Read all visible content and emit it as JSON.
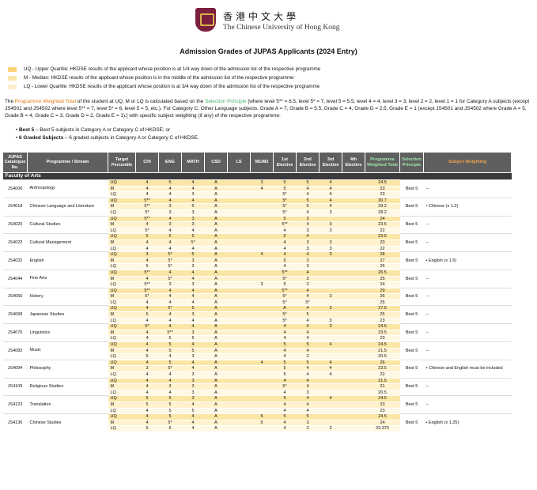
{
  "header": {
    "university_cn": "香港中文大學",
    "university_en": "The Chinese University of Hong Kong"
  },
  "title": "Admission Grades of JUPAS Applicants (2024 Entry)",
  "legend": [
    {
      "text": "UQ - Upper Quartile:  HKDSE results of the applicant whose position is at 1/4 way down of the admission list of the respective programme",
      "color": "#fbd27a"
    },
    {
      "text": "M - Median:  HKDSE results of the applicant whose position is in the middle of the admission list of the respective programme",
      "color": "#fce4a8"
    },
    {
      "text": "LQ - Lower Quartile:  HKDSE results of the applicant whose position is at 3/4 way down of the admission list of the respective programme",
      "color": "#fdeecb"
    }
  ],
  "note": {
    "p1": "The ",
    "pwt": "Programme Weighted Total",
    "p2": " of the student at UQ, M or LQ is calculated based on the ",
    "sp": "Selection Principle",
    "p3": " [where level 5** = 8.5, level 5* = 7, level 5 = 5.5, level 4 = 4, level 3 = 3, level 2 = 2, level 1 = 1 for Category A subjects (except JS4501 and JS4502 where level 5** = 7, level 5* = 6, level 5 = 5, etc.). For Category C: Other Language subjects, Grade A = 7, Grade B = 5.5, Grade C = 4, Grade D = 2.5, Grade E = 1 (except JS4501 and JS4502 where Grade A = 5, Grade B = 4, Grade C = 3, Grade D = 2, Grade E = 1).] with specific subject weighting (if any) of the respective programme:"
  },
  "bullets": [
    {
      "bold": "Best 5",
      "text": " – Best 5 subjects in Category A or Category C of HKDSE; or"
    },
    {
      "bold": "6 Graded Subjects",
      "text": " – 6 graded subjects in Category A or Category C of HKDSE."
    }
  ],
  "table": {
    "headers": {
      "catalogue": "JUPAS Catalogue No.",
      "programme": "Programme / Stream",
      "target": "Target Percentile",
      "chi": "CHI",
      "eng": "ENG",
      "math": "MATH",
      "csd": "CSD",
      "ls": "LS",
      "m1m2": "M1/M2",
      "e1": "1st Elective",
      "e2": "2nd Elective",
      "e3": "3rd Elective",
      "e4": "4th Elective",
      "pwt": "Programme Weighted Total",
      "sel": "Selection Principle",
      "wt": "Subject Weighting"
    },
    "faculty": "Faculty of Arts",
    "programmes": [
      {
        "code": "JS4006",
        "name": "Anthropology",
        "sel": "Best 5",
        "weight": "--",
        "rows": [
          {
            "p": "UQ",
            "chi": "4",
            "eng": "5",
            "math": "4",
            "csd": "A",
            "ls": "",
            "m": "3",
            "e1": "5",
            "e2": "5",
            "e3": "4",
            "e4": "",
            "total": "24.5"
          },
          {
            "p": "M",
            "chi": "4",
            "eng": "4",
            "math": "4",
            "csd": "A",
            "ls": "",
            "m": "4",
            "e1": "5",
            "e2": "4",
            "e3": "4",
            "e4": "",
            "total": "23"
          },
          {
            "p": "LQ",
            "chi": "4",
            "eng": "4",
            "math": "3",
            "csd": "A",
            "ls": "",
            "m": "",
            "e1": "5*",
            "e2": "4",
            "e3": "4",
            "e4": "",
            "total": "23"
          }
        ]
      },
      {
        "code": "JS4018",
        "name": "Chinese Language and Literature",
        "sel": "Best 5",
        "weight": "• Chinese (x 1.2)",
        "rows": [
          {
            "p": "UQ",
            "chi": "5**",
            "eng": "4",
            "math": "4",
            "csd": "A",
            "ls": "",
            "m": "",
            "e1": "5*",
            "e2": "5",
            "e3": "4",
            "e4": "",
            "total": "30.7"
          },
          {
            "p": "M",
            "chi": "5**",
            "eng": "3",
            "math": "5",
            "csd": "A",
            "ls": "",
            "m": "",
            "e1": "5*",
            "e2": "5",
            "e3": "4",
            "e4": "",
            "total": "29.2"
          },
          {
            "p": "LQ",
            "chi": "5*",
            "eng": "3",
            "math": "3",
            "csd": "A",
            "ls": "",
            "m": "",
            "e1": "5*",
            "e2": "4",
            "e3": "3",
            "e4": "",
            "total": "28.2"
          }
        ]
      },
      {
        "code": "JS4020",
        "name": "Cultural Studies",
        "sel": "Best 5",
        "weight": "--",
        "rows": [
          {
            "p": "UQ",
            "chi": "5**",
            "eng": "4",
            "math": "3",
            "csd": "A",
            "ls": "",
            "m": "",
            "e1": "5",
            "e2": "3",
            "e3": "",
            "e4": "",
            "total": "24"
          },
          {
            "p": "M",
            "chi": "4",
            "eng": "3",
            "math": "3",
            "csd": "A",
            "ls": "",
            "m": "",
            "e1": "5**",
            "e2": "4",
            "e3": "3",
            "e4": "",
            "total": "23.5"
          },
          {
            "p": "LQ",
            "chi": "5*",
            "eng": "4",
            "math": "4",
            "csd": "A",
            "ls": "",
            "m": "",
            "e1": "4",
            "e2": "3",
            "e3": "3",
            "e4": "",
            "total": "22"
          }
        ]
      },
      {
        "code": "JS4022",
        "name": "Cultural Management",
        "sel": "Best 5",
        "weight": "--",
        "rows": [
          {
            "p": "UQ",
            "chi": "5",
            "eng": "5",
            "math": "5",
            "csd": "A",
            "ls": "",
            "m": "",
            "e1": "5",
            "e2": "4",
            "e3": "",
            "e4": "",
            "total": "23.5"
          },
          {
            "p": "M",
            "chi": "4",
            "eng": "4",
            "math": "5*",
            "csd": "A",
            "ls": "",
            "m": "",
            "e1": "4",
            "e2": "3",
            "e3": "3",
            "e4": "",
            "total": "23"
          },
          {
            "p": "LQ",
            "chi": "4",
            "eng": "4",
            "math": "4",
            "csd": "A",
            "ls": "",
            "m": "",
            "e1": "4",
            "e2": "3",
            "e3": "3",
            "e4": "",
            "total": "22"
          }
        ]
      },
      {
        "code": "JS4032",
        "name": "English",
        "sel": "Best 5",
        "weight": "• English (x 1.5)",
        "rows": [
          {
            "p": "UQ",
            "chi": "3",
            "eng": "5*",
            "math": "5",
            "csd": "A",
            "ls": "",
            "m": "4",
            "e1": "4",
            "e2": "4",
            "e3": "3",
            "e4": "",
            "total": "28"
          },
          {
            "p": "M",
            "chi": "4",
            "eng": "5*",
            "math": "3",
            "csd": "A",
            "ls": "",
            "m": "",
            "e1": "5",
            "e2": "3",
            "e3": "",
            "e4": "",
            "total": "27"
          },
          {
            "p": "LQ",
            "chi": "5",
            "eng": "5*",
            "math": "3",
            "csd": "A",
            "ls": "",
            "m": "",
            "e1": "4",
            "e2": "3",
            "e3": "",
            "e4": "",
            "total": "26"
          }
        ]
      },
      {
        "code": "JS4044",
        "name": "Fine Arts",
        "sel": "Best 5",
        "weight": "--",
        "rows": [
          {
            "p": "UQ",
            "chi": "5**",
            "eng": "4",
            "math": "4",
            "csd": "A",
            "ls": "",
            "m": "",
            "e1": "5**",
            "e2": "4",
            "e3": "",
            "e4": "",
            "total": "26.5"
          },
          {
            "p": "M",
            "chi": "4",
            "eng": "5*",
            "math": "4",
            "csd": "A",
            "ls": "",
            "m": "",
            "e1": "5*",
            "e2": "3",
            "e3": "",
            "e4": "",
            "total": "25"
          },
          {
            "p": "LQ",
            "chi": "5**",
            "eng": "3",
            "math": "3",
            "csd": "A",
            "ls": "",
            "m": "3",
            "e1": "5",
            "e2": "3",
            "e3": "",
            "e4": "",
            "total": "24"
          }
        ]
      },
      {
        "code": "JS4056",
        "name": "History",
        "sel": "Best 5",
        "weight": "--",
        "rows": [
          {
            "p": "UQ",
            "chi": "5**",
            "eng": "4",
            "math": "4",
            "csd": "A",
            "ls": "",
            "m": "",
            "e1": "5**",
            "e2": "4",
            "e3": "",
            "e4": "",
            "total": "29"
          },
          {
            "p": "M",
            "chi": "5*",
            "eng": "4",
            "math": "4",
            "csd": "A",
            "ls": "",
            "m": "",
            "e1": "5*",
            "e2": "4",
            "e3": "3",
            "e4": "",
            "total": "26"
          },
          {
            "p": "LQ",
            "chi": "4",
            "eng": "4",
            "math": "4",
            "csd": "A",
            "ls": "",
            "m": "",
            "e1": "5*",
            "e2": "5*",
            "e3": "",
            "e4": "",
            "total": "25"
          }
        ]
      },
      {
        "code": "JS4068",
        "name": "Japanese Studies",
        "sel": "Best 5",
        "weight": "--",
        "rows": [
          {
            "p": "UQ",
            "chi": "4",
            "eng": "5*",
            "math": "5",
            "csd": "A",
            "ls": "",
            "m": "",
            "e1": "A",
            "e2": "4",
            "e3": "3",
            "e4": "",
            "total": "27.5"
          },
          {
            "p": "M",
            "chi": "5",
            "eng": "4",
            "math": "3",
            "csd": "A",
            "ls": "",
            "m": "",
            "e1": "5*",
            "e2": "5",
            "e3": "",
            "e4": "",
            "total": "25"
          },
          {
            "p": "LQ",
            "chi": "4",
            "eng": "4",
            "math": "4",
            "csd": "A",
            "ls": "",
            "m": "",
            "e1": "5*",
            "e2": "4",
            "e3": "3",
            "e4": "",
            "total": "23"
          }
        ]
      },
      {
        "code": "JS4070",
        "name": "Linguistics",
        "sel": "Best 5",
        "weight": "--",
        "rows": [
          {
            "p": "UQ",
            "chi": "5*",
            "eng": "4",
            "math": "4",
            "csd": "A",
            "ls": "",
            "m": "",
            "e1": "4",
            "e2": "4",
            "e3": "3",
            "e4": "",
            "total": "24.5"
          },
          {
            "p": "M",
            "chi": "4",
            "eng": "5**",
            "math": "3",
            "csd": "A",
            "ls": "",
            "m": "",
            "e1": "4",
            "e2": "4",
            "e3": "",
            "e4": "",
            "total": "23.5"
          },
          {
            "p": "LQ",
            "chi": "4",
            "eng": "5",
            "math": "5",
            "csd": "A",
            "ls": "",
            "m": "",
            "e1": "4",
            "e2": "4",
            "e3": "",
            "e4": "",
            "total": "23"
          }
        ]
      },
      {
        "code": "JS4082",
        "name": "Music",
        "sel": "Best 5",
        "weight": "--",
        "rows": [
          {
            "p": "UQ",
            "chi": "4",
            "eng": "5",
            "math": "4",
            "csd": "A",
            "ls": "",
            "m": "",
            "e1": "5",
            "e2": "5",
            "e3": "4",
            "e4": "",
            "total": "24.5"
          },
          {
            "p": "M",
            "chi": "4",
            "eng": "5",
            "math": "5",
            "csd": "A",
            "ls": "",
            "m": "",
            "e1": "4",
            "e2": "4",
            "e3": "",
            "e4": "",
            "total": "21.5"
          },
          {
            "p": "LQ",
            "chi": "5",
            "eng": "4",
            "math": "3",
            "csd": "A",
            "ls": "",
            "m": "",
            "e1": "4",
            "e2": "3",
            "e3": "",
            "e4": "",
            "total": "20.5"
          }
        ]
      },
      {
        "code": "JS4094",
        "name": "Philosophy",
        "sel": "Best 5",
        "weight": "• Chinese and English must be included",
        "rows": [
          {
            "p": "UQ",
            "chi": "4",
            "eng": "5",
            "math": "4",
            "csd": "A",
            "ls": "",
            "m": "4",
            "e1": "5",
            "e2": "5",
            "e3": "4",
            "e4": "",
            "total": "26"
          },
          {
            "p": "M",
            "chi": "3",
            "eng": "5*",
            "math": "4",
            "csd": "A",
            "ls": "",
            "m": "",
            "e1": "5",
            "e2": "4",
            "e3": "4",
            "e4": "",
            "total": "23.5"
          },
          {
            "p": "LQ",
            "chi": "4",
            "eng": "4",
            "math": "3",
            "csd": "A",
            "ls": "",
            "m": "",
            "e1": "5",
            "e2": "4",
            "e3": "4",
            "e4": "",
            "total": "22"
          }
        ]
      },
      {
        "code": "JS4109",
        "name": "Religious Studies",
        "sel": "Best 5",
        "weight": "--",
        "rows": [
          {
            "p": "UQ",
            "chi": "4",
            "eng": "4",
            "math": "3",
            "csd": "A",
            "ls": "",
            "m": "",
            "e1": "4",
            "e2": "4",
            "e3": "",
            "e4": "",
            "total": "21.5"
          },
          {
            "p": "M",
            "chi": "4",
            "eng": "3",
            "math": "3",
            "csd": "A",
            "ls": "",
            "m": "",
            "e1": "5*",
            "e2": "4",
            "e3": "",
            "e4": "",
            "total": "21"
          },
          {
            "p": "LQ",
            "chi": "4",
            "eng": "4",
            "math": "3",
            "csd": "A",
            "ls": "",
            "m": "",
            "e1": "4",
            "e2": "3",
            "e3": "",
            "e4": "",
            "total": "20.5"
          }
        ]
      },
      {
        "code": "JS4123",
        "name": "Translation",
        "sel": "Best 5",
        "weight": "--",
        "rows": [
          {
            "p": "UQ",
            "chi": "5",
            "eng": "5",
            "math": "3",
            "csd": "A",
            "ls": "",
            "m": "",
            "e1": "5",
            "e2": "4",
            "e3": "4",
            "e4": "",
            "total": "24.5"
          },
          {
            "p": "M",
            "chi": "5",
            "eng": "5",
            "math": "4",
            "csd": "A",
            "ls": "",
            "m": "",
            "e1": "4",
            "e2": "4",
            "e3": "",
            "e4": "",
            "total": "23"
          },
          {
            "p": "LQ",
            "chi": "4",
            "eng": "5",
            "math": "5",
            "csd": "A",
            "ls": "",
            "m": "",
            "e1": "4",
            "e2": "4",
            "e3": "",
            "e4": "",
            "total": "23"
          }
        ]
      },
      {
        "code": "JS4136",
        "name": "Chinese Studies",
        "sel": "Best 5",
        "weight": "• English (x 1.25)",
        "rows": [
          {
            "p": "UQ",
            "chi": "4",
            "eng": "5",
            "math": "4",
            "csd": "A",
            "ls": "",
            "m": "5",
            "e1": "5",
            "e2": "5",
            "e3": "",
            "e4": "",
            "total": "24.5"
          },
          {
            "p": "M",
            "chi": "4",
            "eng": "5*",
            "math": "4",
            "csd": "A",
            "ls": "",
            "m": "5",
            "e1": "4",
            "e2": "3",
            "e3": "",
            "e4": "",
            "total": "24"
          },
          {
            "p": "LQ",
            "chi": "5",
            "eng": "5",
            "math": "4",
            "csd": "A",
            "ls": "",
            "m": "",
            "e1": "4",
            "e2": "3",
            "e3": "3",
            "e4": "",
            "total": "23.375"
          }
        ]
      }
    ]
  }
}
